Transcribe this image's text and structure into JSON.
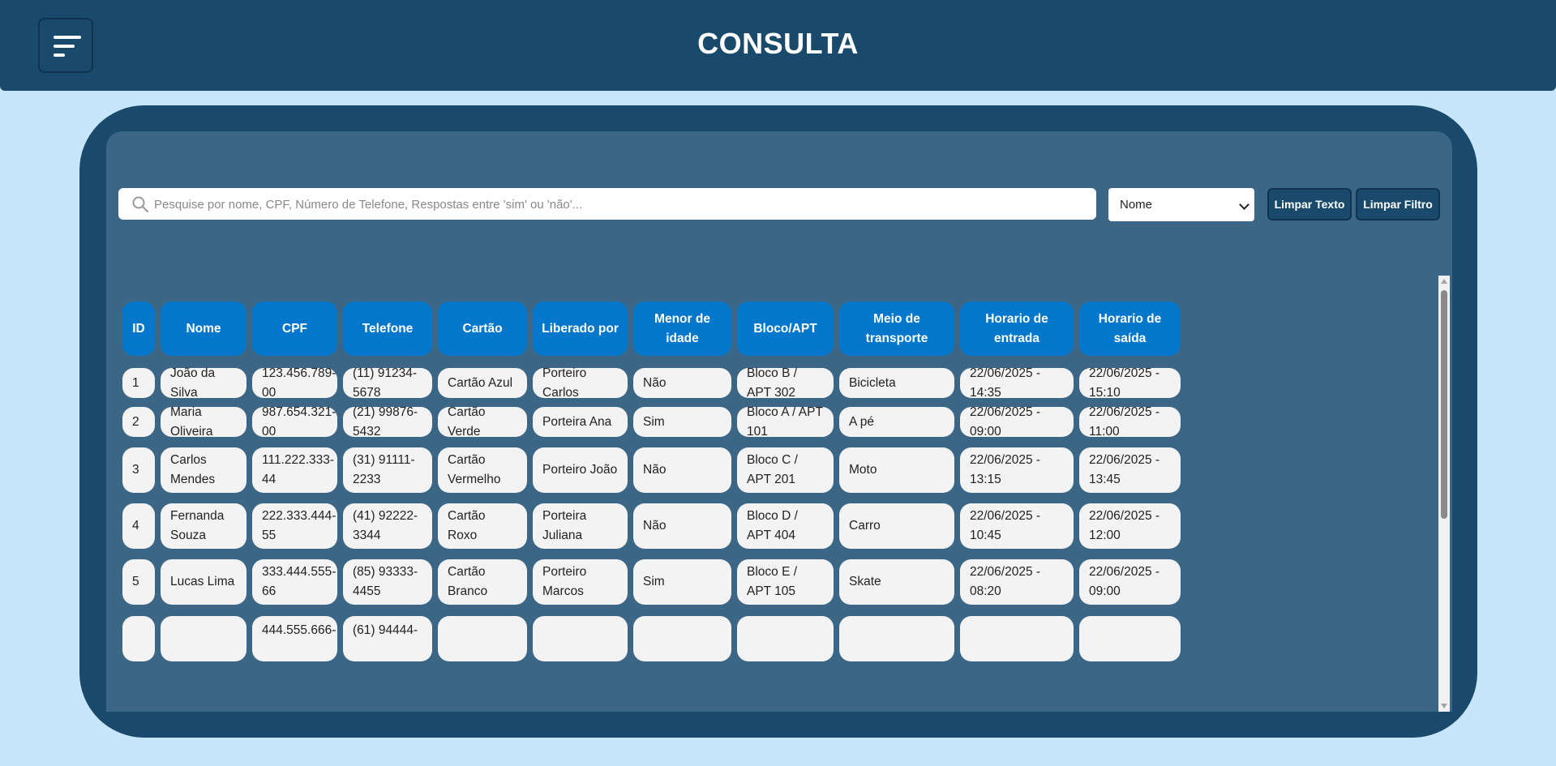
{
  "header": {
    "title": "CONSULTA",
    "menu_icon": "hamburger-menu-icon"
  },
  "search": {
    "placeholder": "Pesquise por nome, CPF, Número de Telefone, Respostas entre 'sim' ou 'não'...",
    "value": "",
    "icon": "search-icon"
  },
  "filter": {
    "selected": "Nome"
  },
  "buttons": {
    "clear_text": "Limpar Texto",
    "clear_filter": "Limpar Filtro"
  },
  "colors": {
    "header_bg": "#1a4a6b",
    "page_bg": "#c7e6fb",
    "panel_bg": "#3b6685",
    "table_header": "#0277cc",
    "cell_bg": "#f3f3f3"
  },
  "table": {
    "columns": [
      "ID",
      "Nome",
      "CPF",
      "Telefone",
      "Cartão",
      "Liberado por",
      "Menor de idade",
      "Bloco/APT",
      "Meio de transporte",
      "Horario de entrada",
      "Horario de saída"
    ],
    "rows": [
      [
        "1",
        "João da Silva",
        "123.456.789-00",
        "(11) 91234-5678",
        "Cartão Azul",
        "Porteiro Carlos",
        "Não",
        "Bloco B / APT 302",
        "Bicicleta",
        "22/06/2025 - 14:35",
        "22/06/2025 - 15:10"
      ],
      [
        "2",
        "Maria Oliveira",
        "987.654.321-00",
        "(21) 99876-5432",
        "Cartão Verde",
        "Porteira Ana",
        "Sim",
        "Bloco A / APT 101",
        "A pé",
        "22/06/2025 - 09:00",
        "22/06/2025 - 11:00"
      ],
      [
        "3",
        "Carlos Mendes",
        "111.222.333-44",
        "(31) 91111-2233",
        "Cartão Vermelho",
        "Porteiro João",
        "Não",
        "Bloco C / APT 201",
        "Moto",
        "22/06/2025 - 13:15",
        "22/06/2025 - 13:45"
      ],
      [
        "4",
        "Fernanda Souza",
        "222.333.444-55",
        "(41) 92222-3344",
        "Cartão Roxo",
        "Porteira Juliana",
        "Não",
        "Bloco D / APT 404",
        "Carro",
        "22/06/2025 - 10:45",
        "22/06/2025 - 12:00"
      ],
      [
        "5",
        "Lucas Lima",
        "333.444.555-66",
        "(85) 93333-4455",
        "Cartão Branco",
        "Porteiro Marcos",
        "Sim",
        "Bloco E / APT 105",
        "Skate",
        "22/06/2025 - 08:20",
        "22/06/2025 - 09:00"
      ],
      [
        "",
        "",
        "444.555.666-",
        "(61) 94444-",
        "",
        "",
        "",
        "",
        "",
        "",
        ""
      ]
    ]
  }
}
